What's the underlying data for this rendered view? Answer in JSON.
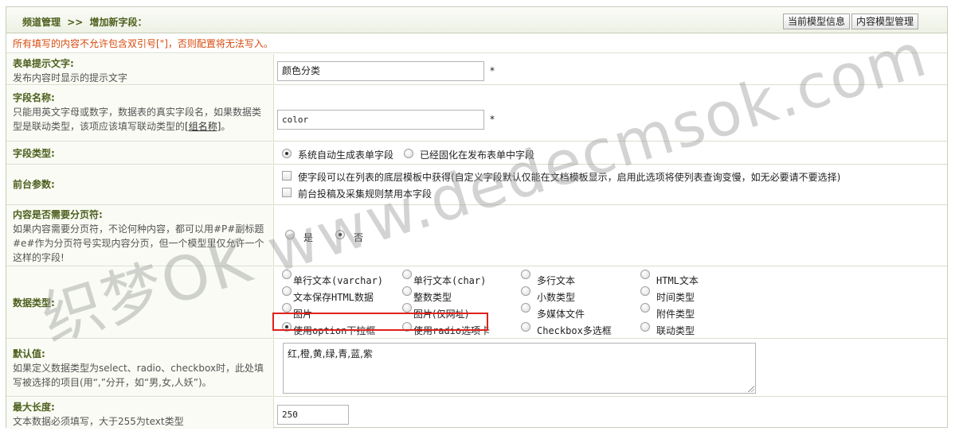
{
  "header": {
    "crumb_root": "频道管理",
    "crumb_sep": ">>",
    "crumb_current": "增加新字段：",
    "btn_model_info": "当前模型信息",
    "btn_model_manage": "内容模型管理"
  },
  "notice": "所有填写的内容不允许包含双引号[\"]，否则配置将无法写入。",
  "fields": {
    "prompt": {
      "title": "表单提示文字:",
      "desc": "发布内容时显示的提示文字",
      "value": "颜色分类",
      "required": "*"
    },
    "name": {
      "title": "字段名称:",
      "desc_a": "只能用英文字母或数字，数据表的真实字段名，如果数据类型是联动类型，该项应该填写联动类型的",
      "desc_link": "[组名称]",
      "desc_b": "。",
      "value": "color",
      "required": "*"
    },
    "type": {
      "title": "字段类型:",
      "opt1": "系统自动生成表单字段",
      "opt2": "已经固化在发布表单中字段"
    },
    "front": {
      "title": "前台参数:",
      "opt1": "使字段可以在列表的底层模板中获得(自定义字段默认仅能在文档模板显示，启用此选项将使列表查询变慢，如无必要请不要选择)",
      "opt2": "前台投稿及采集规则禁用本字段"
    },
    "paging": {
      "title": "内容是否需要分页符:",
      "desc": "如果内容需要分页符，不论何种内容，都可以用#P#副标题#e#作为分页符号实现内容分页，但一个模型里仅允许一个这样的字段!",
      "yes": "是",
      "no": "否"
    },
    "datatype": {
      "title": "数据类型:",
      "options": [
        [
          "单行文本(varchar)",
          "单行文本(char)",
          "多行文本",
          "HTML文本"
        ],
        [
          "文本保存HTML数据",
          "整数类型",
          "小数类型",
          "时间类型"
        ],
        [
          "图片",
          "图片(仅网址)",
          "多媒体文件",
          "附件类型"
        ],
        [
          "使用option下拉框",
          "使用radio选项卡",
          "Checkbox多选框",
          "联动类型"
        ]
      ]
    },
    "default": {
      "title": "默认值:",
      "desc": "如果定义数据类型为select、radio、checkbox时，此处填写被选择的项目(用“,”分开，如“男,女,人妖”)。",
      "value": "红,橙,黄,绿,青,蓝,紫"
    },
    "maxlen": {
      "title": "最大长度:",
      "desc": "文本数据必须填写，大于255为text类型",
      "value": "250"
    }
  },
  "watermark": "织梦OK www.dedecmsok.com"
}
